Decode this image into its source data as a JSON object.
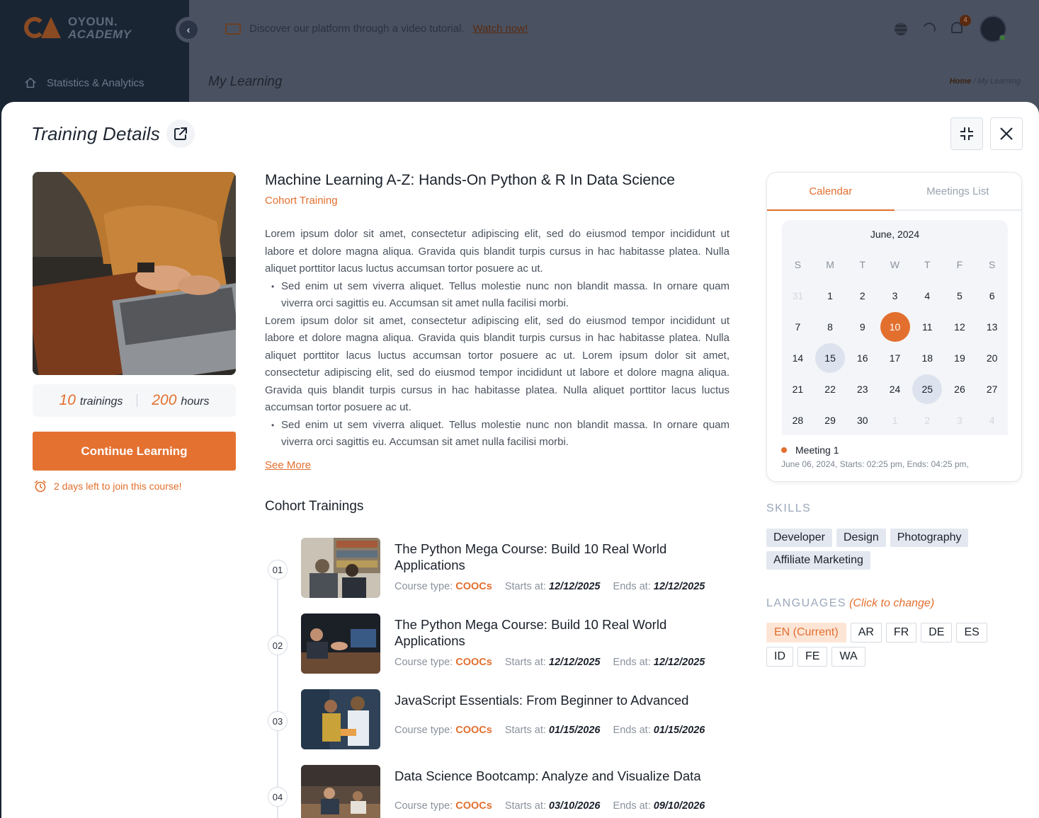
{
  "app": {
    "logo_line1": "OYOUN.",
    "logo_line2": "ACADEMY",
    "nav_item": "Statistics & Analytics",
    "banner_text": "Discover our platform through a video tutorial.",
    "banner_link": "Watch now!",
    "notification_count": "4",
    "page_title": "My Learning",
    "breadcrumb_home": "Home",
    "breadcrumb_sep": "/",
    "breadcrumb_current": "My Learning"
  },
  "modal": {
    "title": "Training Details"
  },
  "course": {
    "title": "Machine Learning A-Z: Hands-On Python & R In Data Science",
    "type": "Cohort Training",
    "trainings_count": "10",
    "trainings_label": "trainings",
    "hours_count": "200",
    "hours_label": "hours",
    "cta_label": "Continue Learning",
    "deadline": "2 days left to join this course!",
    "desc_p1": "Lorem ipsum dolor sit amet, consectetur adipiscing elit, sed do eiusmod tempor incididunt ut labore et dolore magna aliqua. Gravida quis blandit turpis cursus in hac habitasse platea. Nulla aliquet porttitor lacus luctus accumsan tortor posuere ac ut.",
    "desc_b1": "Sed enim ut sem viverra aliquet. Tellus molestie nunc non blandit massa. In ornare quam viverra orci sagittis eu. Accumsan sit amet nulla facilisi morbi.",
    "desc_p2": "Lorem ipsum dolor sit amet, consectetur adipiscing elit, sed do eiusmod tempor incididunt ut labore et dolore magna aliqua. Gravida quis blandit turpis cursus in hac habitasse platea. Nulla aliquet porttitor lacus luctus accumsan tortor posuere ac ut.  Lorem ipsum dolor sit amet, consectetur adipiscing elit, sed do eiusmod tempor incididunt ut labore et dolore magna aliqua. Gravida quis blandit turpis cursus in hac habitasse platea. Nulla aliquet porttitor lacus luctus accumsan tortor posuere ac ut.",
    "desc_b2": "Sed enim ut sem viverra aliquet. Tellus molestie nunc non blandit massa. In ornare quam viverra orci sagittis eu. Accumsan sit amet nulla facilisi morbi.",
    "see_more": "See More"
  },
  "cohort": {
    "heading": "Cohort Trainings",
    "labels": {
      "type": "Course type:",
      "starts": "Starts at:",
      "ends": "Ends at:"
    },
    "items": [
      {
        "num": "01",
        "title": "The Python Mega Course: Build 10 Real World Applications",
        "type": "COOCs",
        "starts": "12/12/2025",
        "ends": "12/12/2025"
      },
      {
        "num": "02",
        "title": "The Python Mega Course: Build 10 Real World Applications",
        "type": "COOCs",
        "starts": "12/12/2025",
        "ends": "12/12/2025"
      },
      {
        "num": "03",
        "title": "JavaScript Essentials: From Beginner to Advanced",
        "type": "COOCs",
        "starts": "01/15/2026",
        "ends": "01/15/2026"
      },
      {
        "num": "04",
        "title": "Data Science Bootcamp: Analyze and Visualize Data",
        "type": "COOCs",
        "starts": "03/10/2026",
        "ends": "09/10/2026"
      }
    ]
  },
  "calendar": {
    "tab_calendar": "Calendar",
    "tab_meetings": "Meetings List",
    "month": "June, 2024",
    "dow": [
      "S",
      "M",
      "T",
      "W",
      "T",
      "F",
      "S"
    ],
    "weeks": [
      [
        "31",
        "1",
        "2",
        "3",
        "4",
        "5",
        "6"
      ],
      [
        "7",
        "8",
        "9",
        "10",
        "11",
        "12",
        "13"
      ],
      [
        "14",
        "15",
        "16",
        "17",
        "18",
        "19",
        "20"
      ],
      [
        "21",
        "22",
        "23",
        "24",
        "25",
        "26",
        "27"
      ],
      [
        "28",
        "29",
        "30",
        "1",
        "2",
        "3",
        "4"
      ]
    ],
    "today": "10",
    "marked": [
      "15",
      "25"
    ],
    "meeting_name": "Meeting 1",
    "meeting_time": "June 06, 2024, Starts: 02:25 pm, Ends: 04:25 pm,"
  },
  "skills": {
    "heading": "SKILLS",
    "items": [
      "Developer",
      "Design",
      "Photography",
      "Affiliate Marketing"
    ]
  },
  "languages": {
    "heading": "LANGUAGES",
    "hint": "(Click to change)",
    "items": [
      "EN (Current)",
      "AR",
      "FR",
      "DE",
      "ES",
      "ID",
      "FE",
      "WA"
    ]
  },
  "colors": {
    "accent": "#e26f2e",
    "primary_button": "#e57131",
    "sidebar": "#1a2534",
    "chip": "#e3e8f0"
  }
}
